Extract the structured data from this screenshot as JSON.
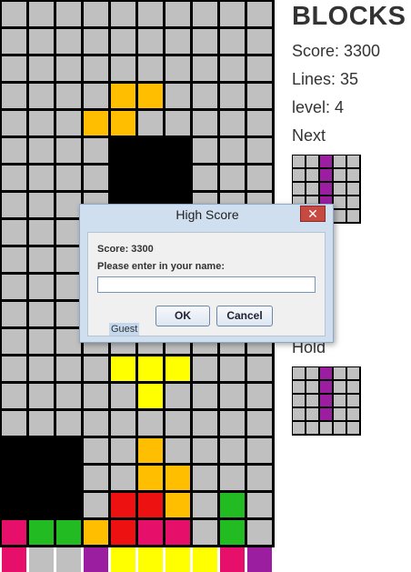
{
  "game": {
    "title": "BLOCKS",
    "score_text": "Score: 3300",
    "lines_text": "Lines: 35",
    "level_text": "level: 4",
    "next_label": "Next",
    "hold_label": "Hold"
  },
  "colors": {
    "empty": "#c0c0c0",
    "grid": "#000000",
    "black": "#000000",
    "orange": "#ffbf00",
    "yellow": "#ffff00",
    "red": "#ee1111",
    "magenta": "#e6106a",
    "green": "#22bb22",
    "purple": "#9b1ea0"
  },
  "board": {
    "rows": [
      "..........",
      "..........",
      "..........",
      "....OO....",
      "...OO.....",
      "....KKK...",
      "....KKK...",
      "....KKK...",
      "..........",
      "..........",
      "..........",
      "..........",
      "..........",
      "....YYY...",
      ".....Y....",
      "...........",
      "KKK..O....",
      "KKK..OO...",
      "KKK.RRO.G.",
      "MGGORMM.G.",
      "M..PYYYYMP"
    ]
  },
  "next_piece": {
    "rows": [
      "..P..",
      "..P..",
      "..P..",
      "..P..",
      "....."
    ]
  },
  "hold_piece": {
    "rows": [
      "..P..",
      "..P..",
      "..P..",
      "..P..",
      "....."
    ]
  },
  "dialog": {
    "title": "High Score",
    "close_glyph": "✕",
    "score_text": "Score: 3300",
    "prompt": "Please enter in your name:",
    "input_value": "Guest",
    "ok_label": "OK",
    "cancel_label": "Cancel"
  }
}
